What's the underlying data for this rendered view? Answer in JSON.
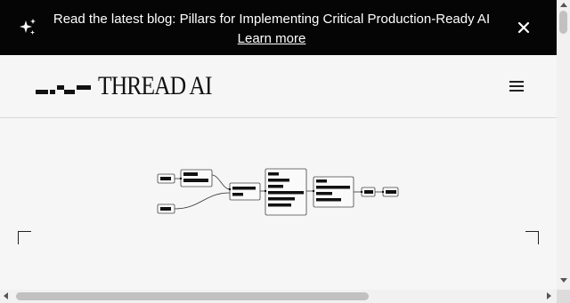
{
  "announcement": {
    "message": "Read the latest blog: Pillars for Implementing Critical Production-Ready AI",
    "link_label": "Learn more"
  },
  "header": {
    "brand": "THREAD AI"
  },
  "icons": {
    "announcement": "sparkle-icon",
    "close": "close-icon",
    "menu": "hamburger-menu-icon"
  },
  "colors": {
    "banner_bg": "#050505",
    "page_bg": "#f6f6f6",
    "ink": "#111111"
  }
}
